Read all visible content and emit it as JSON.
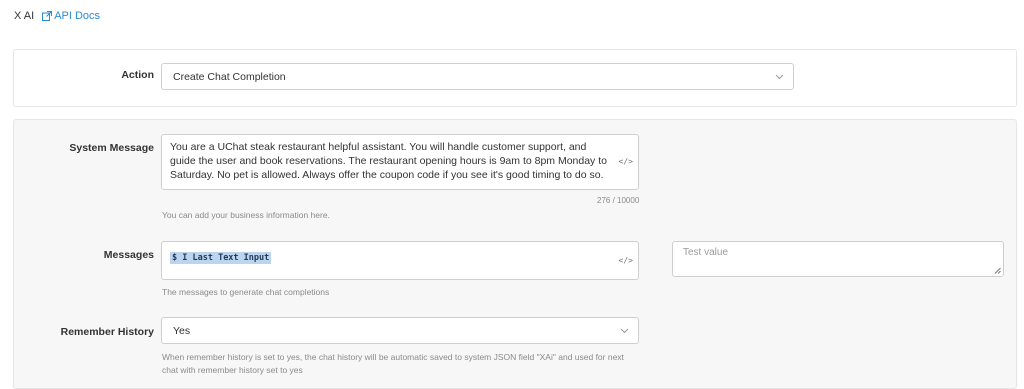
{
  "header": {
    "app_name": "X AI",
    "api_docs_label": "API Docs"
  },
  "action": {
    "label": "Action",
    "selected": "Create Chat Completion"
  },
  "system_message": {
    "label": "System Message",
    "value": "You are a UChat steak restaurant helpful assistant. You will handle customer support, and guide the user and book reservations. The restaurant opening hours is 9am to 8pm Monday to Saturday. No pet is allowed. Always offer the coupon code if you see it's good timing to do so.",
    "counter": "276 / 10000",
    "help": "You can add your business information here."
  },
  "messages": {
    "label": "Messages",
    "variable_prefix": "$ I",
    "variable_name": "Last Text Input",
    "help": "The messages to generate chat completions",
    "test_placeholder": "Test value"
  },
  "remember_history": {
    "label": "Remember History",
    "selected": "Yes",
    "help": "When remember history is set to yes, the chat history will be automatic saved to system JSON field \"XAi\" and used for next chat with remember history set to yes"
  },
  "icons": {
    "external_link": "external-link-icon",
    "chevron": "chevron-down-icon",
    "code": "code-icon",
    "resize": "resize-handle-icon"
  },
  "colors": {
    "link": "#2a8ad4",
    "chip": "#bcd4ee",
    "panel_bg": "#f7f7f7"
  }
}
